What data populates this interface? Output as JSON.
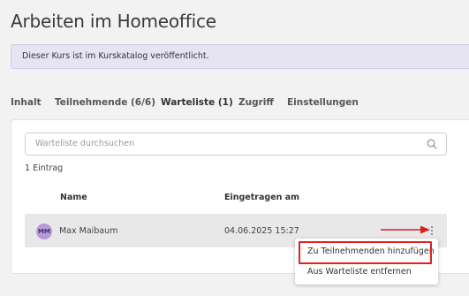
{
  "page": {
    "title": "Arbeiten im Homeoffice"
  },
  "banner": {
    "text": "Dieser Kurs ist im Kurskatalog veröffentlicht."
  },
  "tabs": [
    {
      "label": "Inhalt",
      "active": false
    },
    {
      "label": "Teilnehmende (6/6)",
      "active": false
    },
    {
      "label": "Warteliste (1)",
      "active": true
    },
    {
      "label": "Zugriff",
      "active": false
    },
    {
      "label": "Einstellungen",
      "active": false
    }
  ],
  "search": {
    "placeholder": "Warteliste durchsuchen",
    "value": "",
    "icon": "search-icon"
  },
  "result_count": "1 Eintrag",
  "table": {
    "columns": [
      "Name",
      "Eingetragen am"
    ],
    "rows": [
      {
        "initials": "MM",
        "name": "Max Maibaum",
        "date": "04.06.2025 15:27"
      }
    ]
  },
  "row_menu": {
    "items": [
      {
        "label": "Zu Teilnehmenden hinzufügen",
        "highlighted": true
      },
      {
        "label": "Aus Warteliste entfernen",
        "highlighted": false
      }
    ]
  },
  "colors": {
    "banner_bg": "#e6e4f3",
    "avatar_bg": "#b89ad6",
    "highlight": "#e02020",
    "arrow": "#d62020"
  }
}
